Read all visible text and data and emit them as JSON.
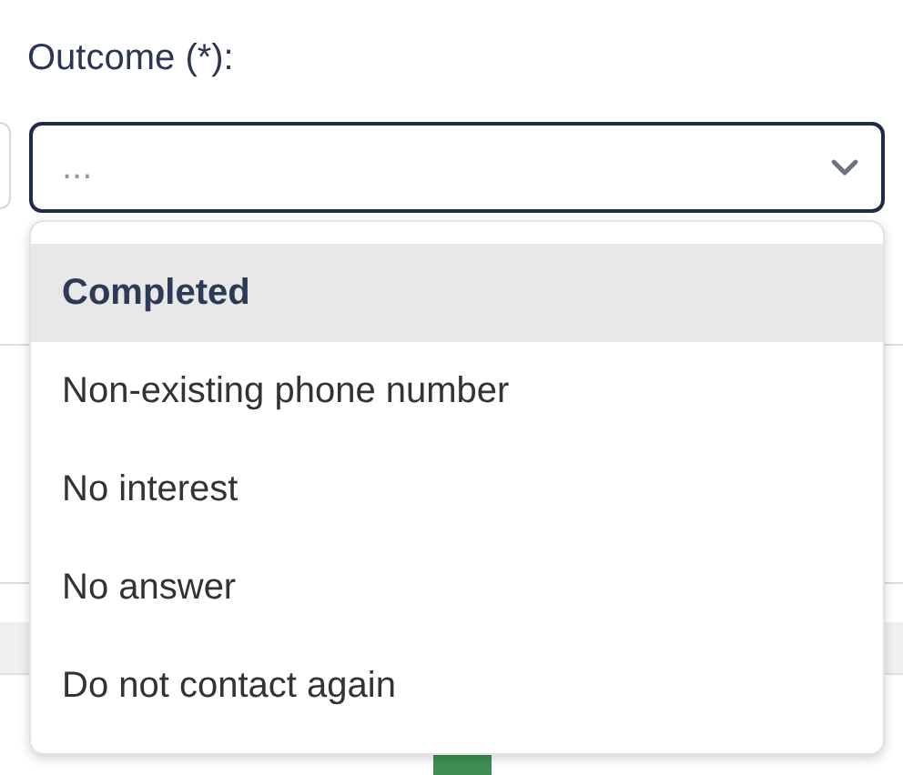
{
  "field": {
    "label": "Outcome (*):",
    "placeholder": "...",
    "expanded": true
  },
  "options": [
    {
      "label": "Completed",
      "selected": true
    },
    {
      "label": "Non-existing phone number",
      "selected": false
    },
    {
      "label": "No interest",
      "selected": false
    },
    {
      "label": "No answer",
      "selected": false
    },
    {
      "label": "Do not contact again",
      "selected": false
    }
  ]
}
